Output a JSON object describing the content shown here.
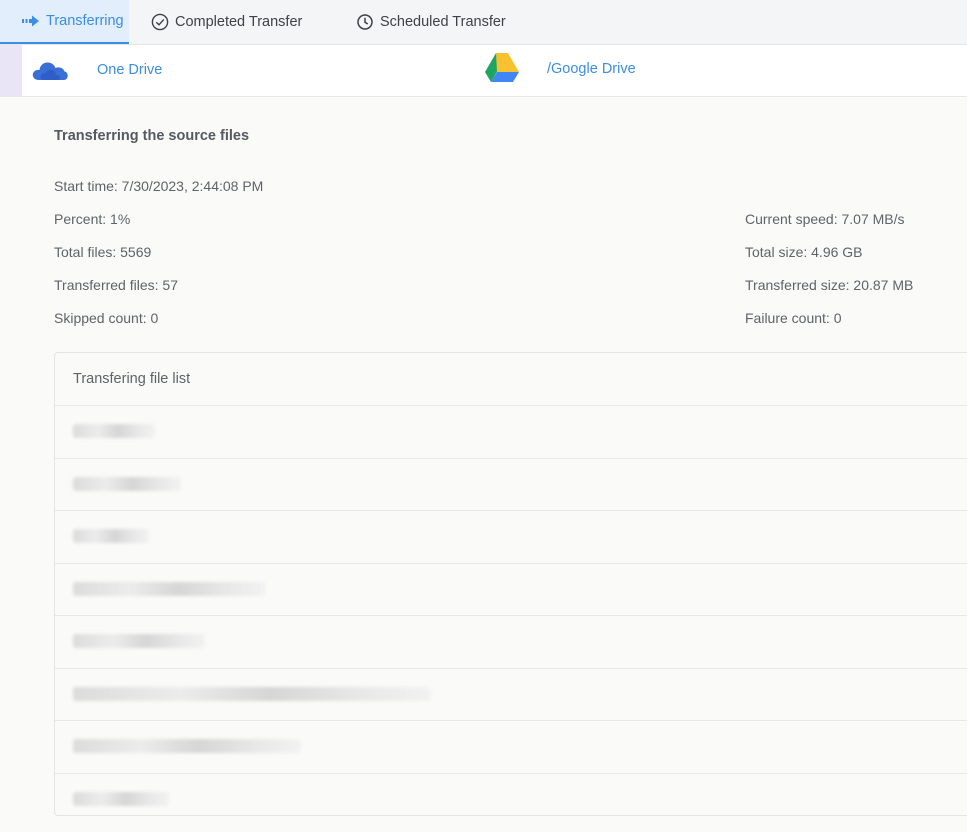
{
  "tabs": [
    {
      "label": "Transferring",
      "icon": "arrow-right-icon",
      "active": true
    },
    {
      "label": "Completed Transfer",
      "icon": "check-circle-icon",
      "active": false
    },
    {
      "label": "Scheduled Transfer",
      "icon": "clock-icon",
      "active": false
    }
  ],
  "route": {
    "source": {
      "label": "One Drive",
      "icon": "onedrive-cloud-icon"
    },
    "destination": {
      "label": "/Google Drive",
      "icon": "google-drive-icon"
    }
  },
  "info": {
    "title": "Transferring the source files",
    "start_time": "Start time: 7/30/2023, 2:44:08 PM",
    "percent": "Percent: 1%",
    "total_files": "Total files: 5569",
    "transferred_files": "Transferred files: 57",
    "skipped_count": "Skipped count: 0",
    "current_speed": "Current speed: 7.07 MB/s",
    "total_size": "Total size: 4.96 GB",
    "transferred_size": "Transferred size: 20.87 MB",
    "failure_count": "Failure count: 0"
  },
  "file_list": {
    "header": "Transfering file list",
    "rows": [
      "",
      "",
      "",
      "",
      "",
      "",
      "",
      ""
    ]
  },
  "colors": {
    "accent": "#3a8ee6",
    "active_tab_bg": "#e3eefc"
  }
}
